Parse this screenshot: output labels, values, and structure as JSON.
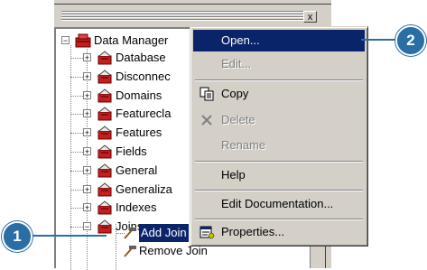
{
  "tree": {
    "root_label": "Data Manager",
    "items": [
      {
        "label": "Database",
        "expander": "+"
      },
      {
        "label": "Disconnec",
        "expander": "+"
      },
      {
        "label": "Domains",
        "expander": "+"
      },
      {
        "label": "Featurecla",
        "expander": "+"
      },
      {
        "label": "Features",
        "expander": "+"
      },
      {
        "label": "Fields",
        "expander": "+"
      },
      {
        "label": "General",
        "expander": "+"
      },
      {
        "label": "Generaliza",
        "expander": "+"
      },
      {
        "label": "Indexes",
        "expander": "+"
      },
      {
        "label": "Joins",
        "expander": "−"
      }
    ],
    "child_selected": "Add Join",
    "child_next": "Remove Join",
    "root_expander": "−"
  },
  "window": {
    "close_label": "x"
  },
  "context_menu": {
    "items": [
      {
        "label": "Open...",
        "state": "highlighted"
      },
      {
        "label": "Edit...",
        "state": "disabled"
      },
      {
        "label": "Copy",
        "state": "enabled",
        "icon": "copy-icon"
      },
      {
        "label": "Delete",
        "state": "disabled",
        "icon": "delete-x-icon"
      },
      {
        "label": "Rename",
        "state": "disabled"
      },
      {
        "label": "Help",
        "state": "enabled"
      },
      {
        "label": "Edit Documentation...",
        "state": "enabled"
      },
      {
        "label": "Properties...",
        "state": "enabled",
        "icon": "properties-icon"
      }
    ]
  },
  "callouts": {
    "one": "1",
    "two": "2"
  },
  "colors": {
    "highlight": "#0a246a",
    "callout": "#2a6ea6",
    "toolbox_red": "#c41e1e"
  }
}
